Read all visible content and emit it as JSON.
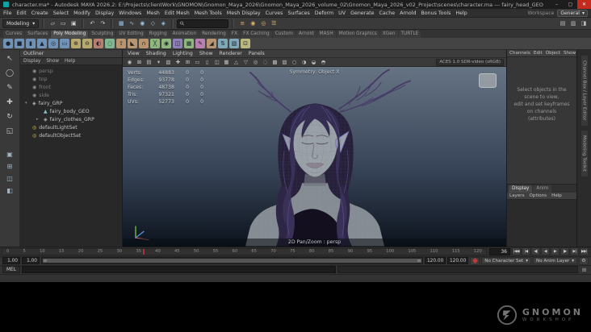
{
  "window": {
    "title": "character.ma* - Autodesk MAYA 2026.2: E:\\Projects\\clientWork\\GNOMON\\Gnomon_Maya_2026\\Gnomon_Maya_2026_volume_02\\Gnomon_Maya_2026_v02_Project\\scenes\\character.ma --- fairy_head_GEO",
    "controls": {
      "min": "–",
      "max": "▢",
      "close": "✕"
    }
  },
  "menu_bar": {
    "items": [
      "File",
      "Edit",
      "Create",
      "Select",
      "Modify",
      "Display",
      "Windows",
      "Mesh",
      "Edit Mesh",
      "Mesh Tools",
      "Mesh Display",
      "Curves",
      "Surfaces",
      "Deform",
      "UV",
      "Generate",
      "Cache",
      "Arnold",
      "Bonus Tools",
      "Help"
    ],
    "workspace_label": "Workspace",
    "workspace_value": "General",
    "workspace_arrow": "▾"
  },
  "status_line": {
    "menuset": "Modeling",
    "menuset_arrow": "▾",
    "file_icons": [
      {
        "name": "new-scene-icon",
        "glyph": "▱"
      },
      {
        "name": "open-scene-icon",
        "glyph": "▭"
      },
      {
        "name": "save-scene-icon",
        "glyph": "▣"
      }
    ],
    "edit_icons": [
      {
        "name": "undo-icon",
        "glyph": "↶"
      },
      {
        "name": "redo-icon",
        "glyph": "↷"
      }
    ],
    "snap_icons": [
      {
        "name": "snap-to-grid-icon",
        "glyph": "▦"
      },
      {
        "name": "snap-to-curve-icon",
        "glyph": "∿"
      },
      {
        "name": "snap-to-point-icon",
        "glyph": "◉"
      },
      {
        "name": "snap-to-plane-icon",
        "glyph": "◇"
      },
      {
        "name": "make-live-icon",
        "glyph": "◈"
      }
    ],
    "render_icons": [
      {
        "name": "construction-history-icon",
        "glyph": "≡"
      },
      {
        "name": "render-icon",
        "glyph": "◉"
      },
      {
        "name": "ipr-render-icon",
        "glyph": "◎"
      },
      {
        "name": "render-settings-icon",
        "glyph": "☰"
      }
    ],
    "right_icons": [
      {
        "name": "channel-box-toggle-icon",
        "glyph": "▤"
      },
      {
        "name": "attribute-editor-toggle-icon",
        "glyph": "▥"
      },
      {
        "name": "tool-settings-toggle-icon",
        "glyph": "◨"
      }
    ],
    "search_placeholder": ""
  },
  "shelf": {
    "tabs": [
      {
        "label": "Curves"
      },
      {
        "label": "Surfaces"
      },
      {
        "label": "Poly Modeling",
        "active": true
      },
      {
        "label": "Sculpting"
      },
      {
        "label": "UV Editing"
      },
      {
        "label": "Rigging"
      },
      {
        "label": "Animation"
      },
      {
        "label": "Rendering"
      },
      {
        "label": "FX"
      },
      {
        "label": "FX Caching"
      },
      {
        "label": "Custom"
      },
      {
        "label": "Arnold"
      },
      {
        "label": "MASH"
      },
      {
        "label": "Motion Graphics"
      },
      {
        "label": "XGen"
      },
      {
        "label": "TURTLE"
      }
    ],
    "icons": [
      {
        "name": "poly-sphere-icon",
        "glyph": "●",
        "c": "#6f93b8"
      },
      {
        "name": "poly-cube-icon",
        "glyph": "■",
        "c": "#6f93b8"
      },
      {
        "name": "poly-cylinder-icon",
        "glyph": "▮",
        "c": "#6f93b8"
      },
      {
        "name": "poly-cone-icon",
        "glyph": "▲",
        "c": "#6f93b8"
      },
      {
        "name": "poly-torus-icon",
        "glyph": "◎",
        "c": "#6f93b8"
      },
      {
        "name": "poly-plane-icon",
        "glyph": "▭",
        "c": "#6f93b8"
      },
      {
        "name": "combine-icon",
        "glyph": "⊕",
        "c": "#b8a96f"
      },
      {
        "name": "separate-icon",
        "glyph": "⊖",
        "c": "#b8a96f"
      },
      {
        "name": "boolean-icon",
        "glyph": "◐",
        "c": "#b87f6f"
      },
      {
        "name": "smooth-icon",
        "glyph": "◌",
        "c": "#7fb88f"
      },
      {
        "name": "extrude-icon",
        "glyph": "⇧",
        "c": "#b8956f"
      },
      {
        "name": "bevel-icon",
        "glyph": "◣",
        "c": "#b8956f"
      },
      {
        "name": "bridge-icon",
        "glyph": "∩",
        "c": "#b8956f"
      },
      {
        "name": "multi-cut-icon",
        "glyph": "╳",
        "c": "#8fb87f"
      },
      {
        "name": "target-weld-icon",
        "glyph": "◉",
        "c": "#8fb87f"
      },
      {
        "name": "mirror-icon",
        "glyph": "◫",
        "c": "#8f7fb8"
      },
      {
        "name": "quad-draw-icon",
        "glyph": "▦",
        "c": "#8fb87f"
      },
      {
        "name": "sculpt-tool-icon",
        "glyph": "✎",
        "c": "#b87fb0"
      },
      {
        "name": "crease-icon",
        "glyph": "◢",
        "c": "#b8956f"
      },
      {
        "name": "normals-icon",
        "glyph": "⇅",
        "c": "#7fa8b8"
      },
      {
        "name": "uv-editor-icon",
        "glyph": "▧",
        "c": "#7fa8b8"
      },
      {
        "name": "center-pivot-icon",
        "glyph": "⊡",
        "c": "#b8b87f"
      }
    ]
  },
  "toolbox": {
    "tools": [
      {
        "name": "select-tool-icon",
        "glyph": "↖"
      },
      {
        "name": "lasso-select-tool-icon",
        "glyph": "◯"
      },
      {
        "name": "paint-select-tool-icon",
        "glyph": "✎"
      },
      {
        "name": "move-tool-icon",
        "glyph": "✚"
      },
      {
        "name": "rotate-tool-icon",
        "glyph": "↻"
      },
      {
        "name": "scale-tool-icon",
        "glyph": "◱"
      }
    ],
    "layouts": [
      {
        "name": "single-pane-layout-icon",
        "glyph": "▣"
      },
      {
        "name": "four-pane-layout-icon",
        "glyph": "⊞"
      },
      {
        "name": "two-pane-layout-icon",
        "glyph": "◫"
      },
      {
        "name": "persp-outliner-layout-icon",
        "glyph": "◧"
      }
    ]
  },
  "outliner": {
    "title": "Outliner",
    "menus": [
      "Display",
      "Show",
      "Help"
    ],
    "items": [
      {
        "name": "persp",
        "depth": "d1",
        "exp": "",
        "glyph": "◉",
        "icon": "camera",
        "muted": true
      },
      {
        "name": "top",
        "depth": "d1",
        "exp": "",
        "glyph": "◉",
        "icon": "camera",
        "muted": true
      },
      {
        "name": "front",
        "depth": "d1",
        "exp": "",
        "glyph": "◉",
        "icon": "camera",
        "muted": true
      },
      {
        "name": "side",
        "depth": "d1",
        "exp": "",
        "glyph": "◉",
        "icon": "camera",
        "muted": true
      },
      {
        "name": "fairy_GRP",
        "depth": "d1",
        "exp": "▾",
        "glyph": "◈",
        "icon": "group"
      },
      {
        "name": "fairy_body_GEO",
        "depth": "d2",
        "exp": "",
        "glyph": "▲",
        "icon": "mesh"
      },
      {
        "name": "fairy_clothes_GRP",
        "depth": "d2",
        "exp": "▸",
        "glyph": "◈",
        "icon": "group"
      },
      {
        "name": "defaultLightSet",
        "depth": "d1",
        "exp": "",
        "glyph": "◎",
        "icon": "set"
      },
      {
        "name": "defaultObjectSet",
        "depth": "d1",
        "exp": "",
        "glyph": "◎",
        "icon": "set"
      }
    ]
  },
  "viewport": {
    "menus": [
      "View",
      "Shading",
      "Lighting",
      "Show",
      "Renderer",
      "Panels"
    ],
    "toolbar_icons": [
      {
        "name": "select-camera-icon",
        "glyph": "◉"
      },
      {
        "name": "lock-camera-icon",
        "glyph": "⊠"
      },
      {
        "name": "camera-attributes-icon",
        "glyph": "▤"
      },
      {
        "name": "bookmarks-icon",
        "glyph": "▾"
      },
      {
        "name": "image-plane-icon",
        "glyph": "▧"
      },
      {
        "name": "2d-pan-zoom-icon",
        "glyph": "✚"
      },
      {
        "name": "grid-toggle-icon",
        "glyph": "⊞"
      },
      {
        "name": "film-gate-icon",
        "glyph": "▭"
      },
      {
        "name": "resolution-gate-icon",
        "glyph": "▯"
      },
      {
        "name": "gate-mask-icon",
        "glyph": "◫"
      },
      {
        "name": "field-chart-icon",
        "glyph": "▦"
      },
      {
        "name": "safe-action-icon",
        "glyph": "△"
      },
      {
        "name": "safe-title-icon",
        "glyph": "▽"
      },
      {
        "name": "isolate-select-icon",
        "glyph": "◎"
      },
      {
        "name": "xray-icon",
        "glyph": "◌"
      },
      {
        "name": "wireframe-on-shaded-icon",
        "glyph": "▩"
      },
      {
        "name": "textured-icon",
        "glyph": "▨"
      },
      {
        "name": "lighting-icon",
        "glyph": "○"
      },
      {
        "name": "shadows-icon",
        "glyph": "◑"
      },
      {
        "name": "ssao-icon",
        "glyph": "◒"
      },
      {
        "name": "anti-aliasing-icon",
        "glyph": "◓"
      }
    ],
    "color_transform": "ACES 1.0 SDR-video (sRGB)",
    "hud": {
      "rows": [
        {
          "label": "Verts:",
          "value": "44883",
          "sel": "0",
          "hilite": "0"
        },
        {
          "label": "Edges:",
          "value": "93778",
          "sel": "0",
          "hilite": "0"
        },
        {
          "label": "Faces:",
          "value": "48738",
          "sel": "0",
          "hilite": "0"
        },
        {
          "label": "Tris:",
          "value": "97321",
          "sel": "0",
          "hilite": "0"
        },
        {
          "label": "UVs:",
          "value": "52773",
          "sel": "0",
          "hilite": "0"
        }
      ],
      "symmetry": "Symmetry: Object X",
      "camera_label": "2D Pan/Zoom : persp"
    }
  },
  "channel_box": {
    "menus": [
      "Channels",
      "Edit",
      "Object",
      "Show"
    ],
    "empty_message": "Select objects in the scene to view,\nedit and set keyframes on channels\n(attributes)",
    "layer_editor": {
      "tabs": [
        {
          "label": "Display",
          "active": true
        },
        {
          "label": "Anim"
        }
      ],
      "menus": [
        "Layers",
        "Options",
        "Help"
      ]
    }
  },
  "right_tabs": [
    {
      "label": "Channel Box / Layer Editor"
    },
    {
      "label": "Modeling Toolkit"
    }
  ],
  "timeline": {
    "ticks": [
      "0",
      "5",
      "10",
      "15",
      "20",
      "25",
      "30",
      "35",
      "40",
      "45",
      "50",
      "55",
      "60",
      "65",
      "70",
      "75",
      "80",
      "85",
      "90",
      "95",
      "100",
      "105",
      "110",
      "115",
      "120"
    ],
    "current_frame": "36"
  },
  "playback": {
    "buttons": [
      {
        "name": "go-to-start-button",
        "glyph": "|◀◀"
      },
      {
        "name": "step-back-frame-button",
        "glyph": "|◀"
      },
      {
        "name": "step-back-key-button",
        "glyph": "◀|"
      },
      {
        "name": "play-backwards-button",
        "glyph": "◀"
      },
      {
        "name": "play-forwards-button",
        "glyph": "▶"
      },
      {
        "name": "step-forward-key-button",
        "glyph": "|▶"
      },
      {
        "name": "step-forward-frame-button",
        "glyph": "▶|"
      },
      {
        "name": "go-to-end-button",
        "glyph": "▶▶|"
      }
    ]
  },
  "range_slider": {
    "start": "1.00",
    "range_start": "1.00",
    "range_end": "120.00",
    "end": "120.00"
  },
  "anim": {
    "character_set": "No Character Set",
    "anim_layer": "No Anim Layer",
    "arrow": "▾"
  },
  "command_line": {
    "label": "MEL",
    "value": ""
  },
  "help_line": {
    "text": ""
  },
  "watermark": {
    "line1": "GNOMON",
    "line2": "WORKSHOP"
  },
  "colors": {
    "accent": "#5285a6",
    "viewport_top": "#667383",
    "viewport_mid": "#39465a",
    "viewport_bottom": "#0c131d",
    "autokey_red": "#c03a3a"
  }
}
